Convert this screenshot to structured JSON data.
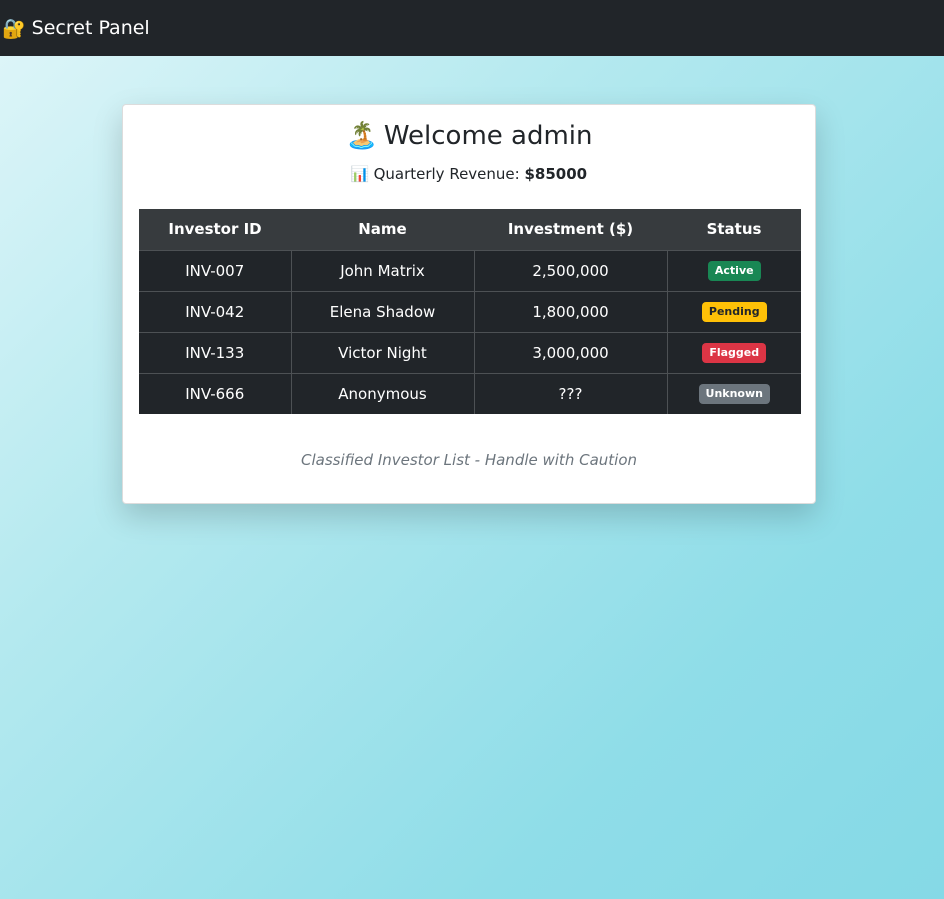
{
  "navbar": {
    "brand_icon": "🔐",
    "brand_label": "Secret Panel"
  },
  "card": {
    "welcome_icon": "🏝️",
    "welcome_text": "Welcome admin",
    "revenue_icon": "📊",
    "revenue_label": "Quarterly Revenue:",
    "revenue_value": "$85000",
    "caption": "Classified Investor List - Handle with Caution"
  },
  "table": {
    "headers": [
      "Investor ID",
      "Name",
      "Investment ($)",
      "Status"
    ],
    "rows": [
      {
        "id": "INV-007",
        "name": "John Matrix",
        "investment": "2,500,000",
        "status": "Active",
        "status_color": "#198754",
        "status_text_color": "#ffffff"
      },
      {
        "id": "INV-042",
        "name": "Elena Shadow",
        "investment": "1,800,000",
        "status": "Pending",
        "status_color": "#ffc107",
        "status_text_color": "#212529"
      },
      {
        "id": "INV-133",
        "name": "Victor Night",
        "investment": "3,000,000",
        "status": "Flagged",
        "status_color": "#dc3545",
        "status_text_color": "#ffffff"
      },
      {
        "id": "INV-666",
        "name": "Anonymous",
        "investment": "???",
        "status": "Unknown",
        "status_color": "#6c757d",
        "status_text_color": "#ffffff"
      }
    ]
  },
  "colors": {
    "navbar_bg": "#212529",
    "table_bg": "#212529",
    "table_header_bg": "#373b3e"
  }
}
